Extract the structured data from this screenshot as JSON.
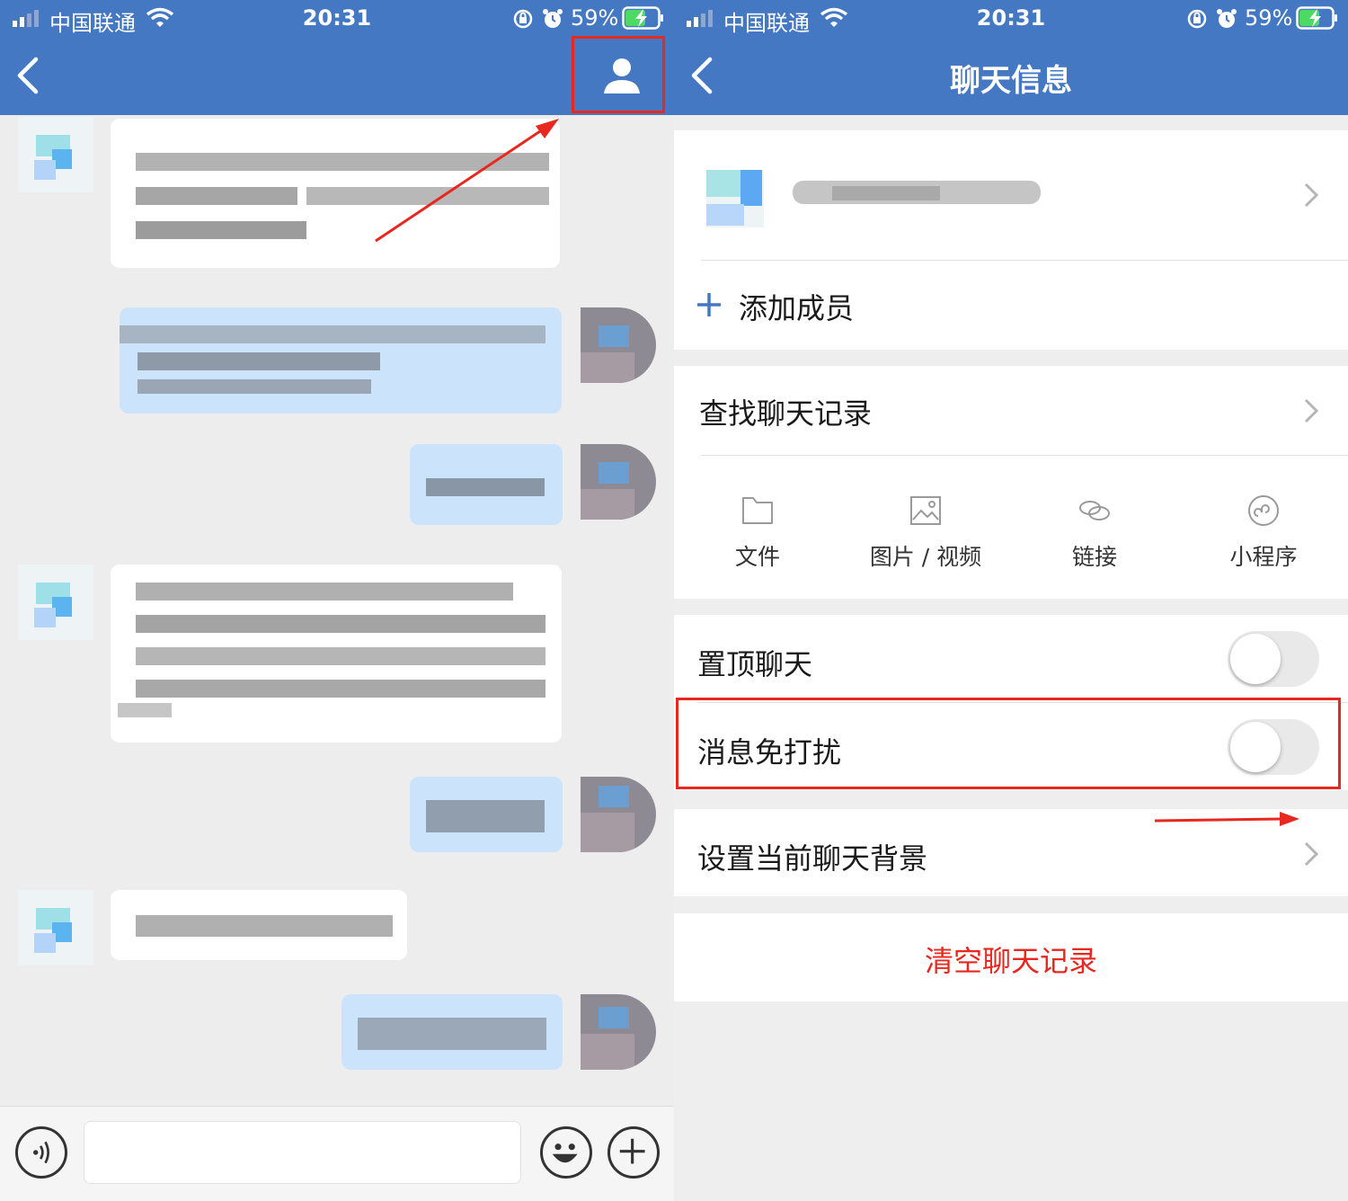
{
  "status_bar": {
    "carrier": "中国联通",
    "time": "20:31",
    "battery_percent": "59%"
  },
  "chat_screen": {
    "header_title": "",
    "input_placeholder": "",
    "icons": [
      "back-icon",
      "person-icon",
      "voice-icon",
      "emoji-icon",
      "plus-icon"
    ]
  },
  "info_screen": {
    "title": "聊天信息",
    "add_member": "添加成员",
    "search_history": "查找聊天记录",
    "media_tools": [
      {
        "label": "文件",
        "icon": "folder-icon"
      },
      {
        "label": "图片 / 视频",
        "icon": "image-icon"
      },
      {
        "label": "链接",
        "icon": "link-icon"
      },
      {
        "label": "小程序",
        "icon": "mini-program-icon"
      }
    ],
    "pin_chat": "置顶聊天",
    "pin_chat_on": false,
    "mute_notifications": "消息免打扰",
    "mute_notifications_on": false,
    "set_background": "设置当前聊天背景",
    "clear_history": "清空聊天记录"
  },
  "colors": {
    "header_blue": "#4478c3",
    "annotation_red": "#e8271f",
    "outgoing_bubble": "#cbe3fb",
    "danger_text": "#e8271f"
  }
}
